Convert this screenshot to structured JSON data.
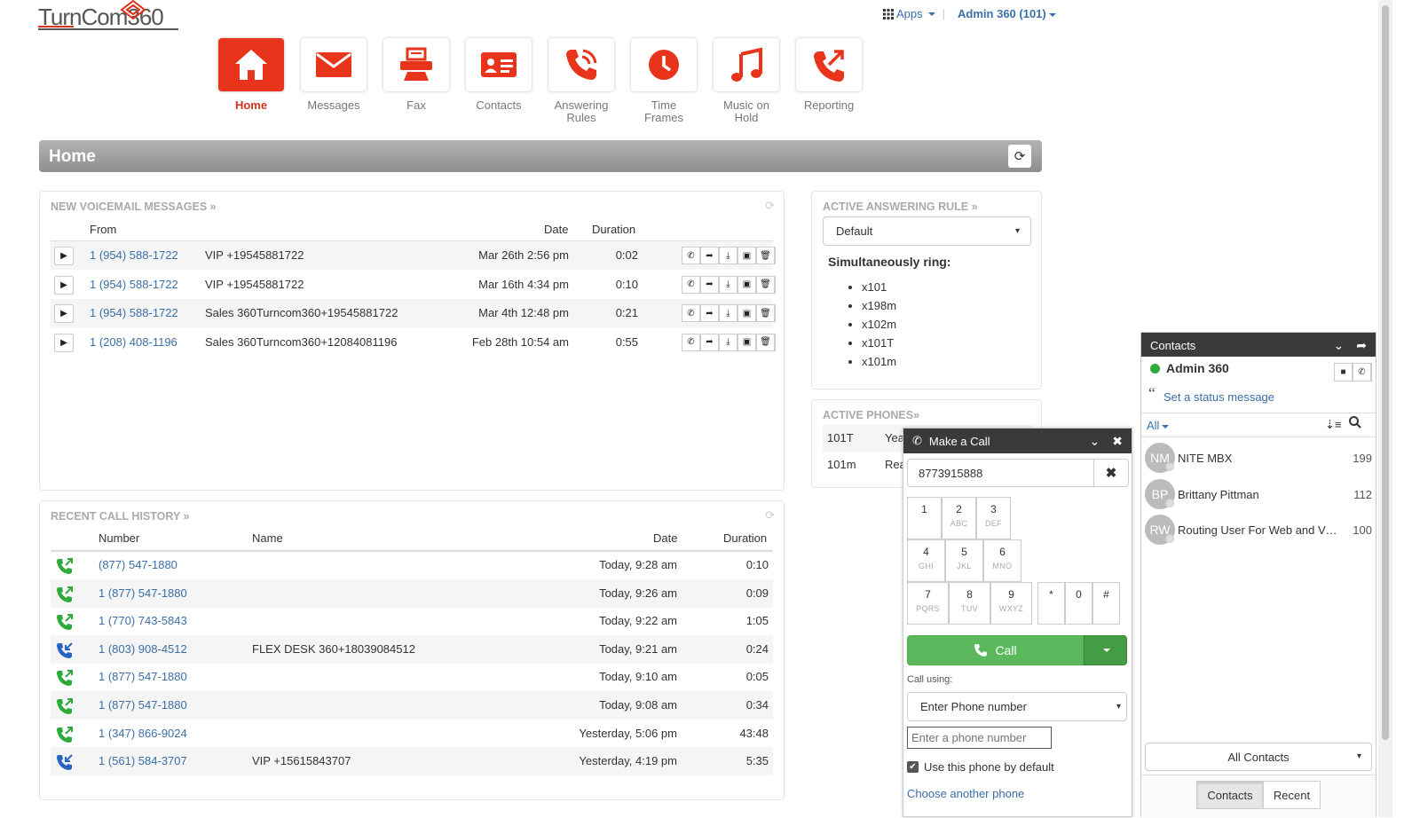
{
  "logo": {
    "text": "TurnCom360"
  },
  "topbar": {
    "apps_label": "Apps",
    "user_label": "Admin 360 (101)"
  },
  "nav": [
    {
      "label": "Home",
      "icon": "home-icon",
      "active": true
    },
    {
      "label": "Messages",
      "icon": "envelope-icon"
    },
    {
      "label": "Fax",
      "icon": "fax-icon"
    },
    {
      "label": "Contacts",
      "icon": "contact-card-icon"
    },
    {
      "label": "Answering Rules",
      "icon": "phone-ring-icon"
    },
    {
      "label": "Time Frames",
      "icon": "clock-icon"
    },
    {
      "label": "Music on Hold",
      "icon": "music-note-icon"
    },
    {
      "label": "Reporting",
      "icon": "phone-arrow-icon"
    }
  ],
  "page": {
    "title": "Home"
  },
  "voicemail": {
    "title": "NEW VOICEMAIL MESSAGES »",
    "headers": {
      "from": "From",
      "date": "Date",
      "duration": "Duration"
    },
    "rows": [
      {
        "number": "1 (954) 588-1722",
        "name": "VIP +19545881722",
        "date": "Mar 26th 2:56 pm",
        "duration": "0:02"
      },
      {
        "number": "1 (954) 588-1722",
        "name": "VIP +19545881722",
        "date": "Mar 16th 4:34 pm",
        "duration": "0:10"
      },
      {
        "number": "1 (954) 588-1722",
        "name": "Sales 360Turncom360+19545881722",
        "date": "Mar 4th 12:48 pm",
        "duration": "0:21"
      },
      {
        "number": "1 (208) 408-1196",
        "name": "Sales 360Turncom360+12084081196",
        "date": "Feb 28th 10:54 am",
        "duration": "0:55"
      }
    ]
  },
  "history": {
    "title": "RECENT CALL HISTORY »",
    "headers": {
      "number": "Number",
      "name": "Name",
      "date": "Date",
      "duration": "Duration"
    },
    "rows": [
      {
        "number": "(877) 547-1880",
        "name": "",
        "date": "Today, 9:28 am",
        "duration": "0:10",
        "type": "outbound"
      },
      {
        "number": "1 (877) 547-1880",
        "name": "",
        "date": "Today, 9:26 am",
        "duration": "0:09",
        "type": "outbound"
      },
      {
        "number": "1 (770) 743-5843",
        "name": "",
        "date": "Today, 9:22 am",
        "duration": "1:05",
        "type": "outbound"
      },
      {
        "number": "1 (803) 908-4512",
        "name": "FLEX DESK 360+18039084512",
        "date": "Today, 9:21 am",
        "duration": "0:24",
        "type": "inbound"
      },
      {
        "number": "1 (877) 547-1880",
        "name": "",
        "date": "Today, 9:10 am",
        "duration": "0:05",
        "type": "outbound"
      },
      {
        "number": "1 (877) 547-1880",
        "name": "",
        "date": "Today, 9:08 am",
        "duration": "0:34",
        "type": "outbound"
      },
      {
        "number": "1 (347) 866-9024",
        "name": "",
        "date": "Yesterday, 5:06 pm",
        "duration": "43:48",
        "type": "outbound"
      },
      {
        "number": "1 (561) 584-3707",
        "name": "VIP +15615843707",
        "date": "Yesterday, 4:19 pm",
        "duration": "5:35",
        "type": "inbound"
      }
    ]
  },
  "answering_rule": {
    "title": "ACTIVE ANSWERING RULE »",
    "selected": "Default",
    "ring_label": "Simultaneously ring:",
    "ring_list": [
      "x101",
      "x198m",
      "x102m",
      "x101T",
      "x101m"
    ]
  },
  "phones": {
    "title": "ACTIVE PHONES»",
    "rows": [
      {
        "name": "101T",
        "status": "Yea"
      },
      {
        "name": "101m",
        "status": "Rea"
      }
    ]
  },
  "make_call": {
    "title": "Make a Call",
    "number": "8773915888",
    "keys": [
      {
        "d": "1",
        "l": ""
      },
      {
        "d": "2",
        "l": "ABC"
      },
      {
        "d": "3",
        "l": "DEF"
      },
      {
        "d": "4",
        "l": "GHI"
      },
      {
        "d": "5",
        "l": "JKL"
      },
      {
        "d": "6",
        "l": "MNO"
      },
      {
        "d": "7",
        "l": "PQRS"
      },
      {
        "d": "8",
        "l": "TUV"
      },
      {
        "d": "9",
        "l": "WXYZ"
      },
      {
        "d": "*",
        "l": ""
      },
      {
        "d": "0",
        "l": ""
      },
      {
        "d": "#",
        "l": ""
      }
    ],
    "call_label": "Call",
    "call_using_label": "Call using:",
    "phone_select": "Enter Phone number",
    "phone_placeholder": "Enter a phone number",
    "default_label": "Use this phone by default",
    "default_checked": true,
    "choose_label": "Choose another phone"
  },
  "contacts": {
    "title": "Contacts",
    "me": "Admin 360",
    "status_link": "Set a status message",
    "filter": "All",
    "list": [
      {
        "initials": "NM",
        "name": "NITE MBX",
        "ext": "199"
      },
      {
        "initials": "BP",
        "name": "Brittany Pittman",
        "ext": "112"
      },
      {
        "initials": "RW",
        "name": "Routing User For Web and Vi…",
        "ext": "100"
      }
    ],
    "scope_select": "All Contacts",
    "tabs": [
      "Contacts",
      "Recent"
    ],
    "active_tab": "Contacts"
  },
  "colors": {
    "brand_red": "#e8341a",
    "link_blue": "#3a6fa8",
    "call_green": "#5cb85c",
    "outbound_green": "#2eaa3a",
    "inbound_blue": "#2563c4"
  }
}
